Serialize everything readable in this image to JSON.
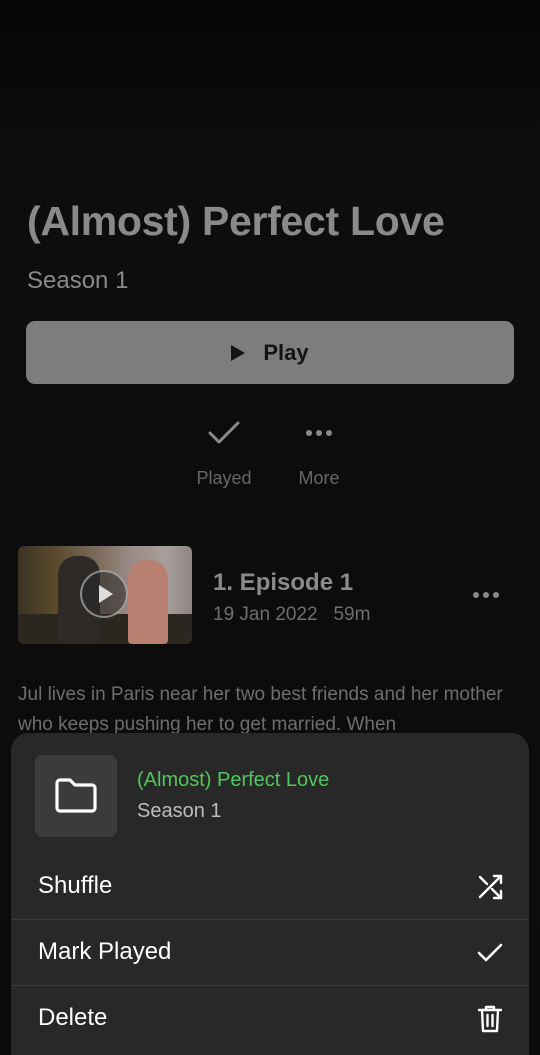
{
  "show": {
    "title": "(Almost) Perfect Love",
    "season": "Season 1",
    "play_label": "Play",
    "actions": {
      "played_label": "Played",
      "more_label": "More"
    }
  },
  "episode": {
    "title": "1. Episode 1",
    "date": "19 Jan 2022",
    "duration": "59m",
    "description": "Jul lives in Paris near her two best friends and her mother who keeps pushing her to get married. When"
  },
  "sheet": {
    "title": "(Almost) Perfect Love",
    "subtitle": "Season 1",
    "items": [
      {
        "label": "Shuffle",
        "icon": "shuffle-icon"
      },
      {
        "label": "Mark Played",
        "icon": "check-icon"
      },
      {
        "label": "Delete",
        "icon": "trash-icon"
      }
    ]
  },
  "colors": {
    "accent": "#54c45e",
    "sheet_bg": "#282828",
    "background": "#0d0d0d"
  }
}
